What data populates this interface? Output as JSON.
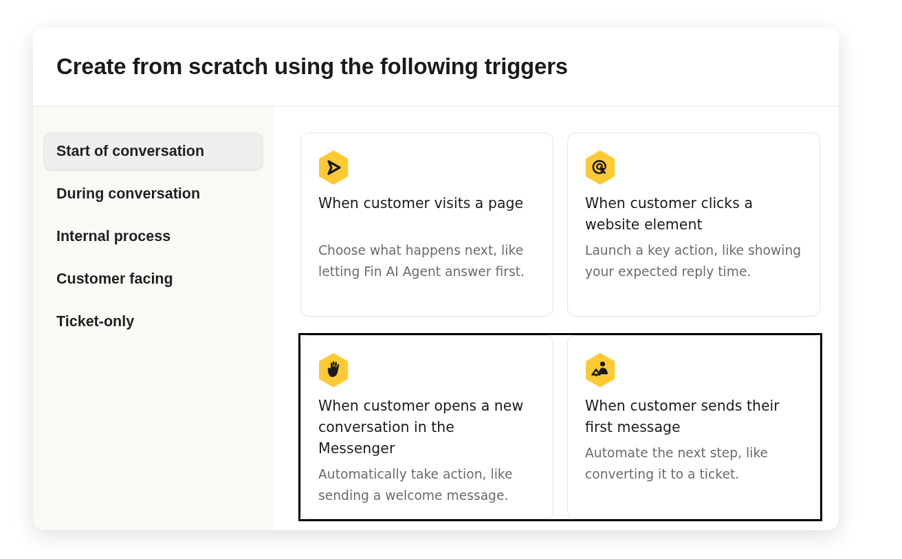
{
  "dialog": {
    "title": "Create from scratch using the following triggers"
  },
  "sidebar": {
    "items": [
      {
        "label": "Start of conversation",
        "selected": true
      },
      {
        "label": "During conversation",
        "selected": false
      },
      {
        "label": "Internal process",
        "selected": false
      },
      {
        "label": "Customer facing",
        "selected": false
      },
      {
        "label": "Ticket-only",
        "selected": false
      }
    ]
  },
  "trigger_rows": [
    {
      "highlighted": false,
      "cards": [
        {
          "title": "When customer visits a page",
          "description": "Choose what happens next, like letting Fin AI Agent answer first."
        },
        {
          "title": "When customer clicks a website element",
          "description": "Launch a key action, like showing your expected reply time."
        }
      ]
    },
    {
      "highlighted": true,
      "cards": [
        {
          "title": "When customer opens a new conversation in the Messenger",
          "description": "Automatically take action, like sending a welcome message."
        },
        {
          "title": "When customer sends their first message",
          "description": "Automate the next step, like converting it to a ticket."
        }
      ]
    }
  ]
}
